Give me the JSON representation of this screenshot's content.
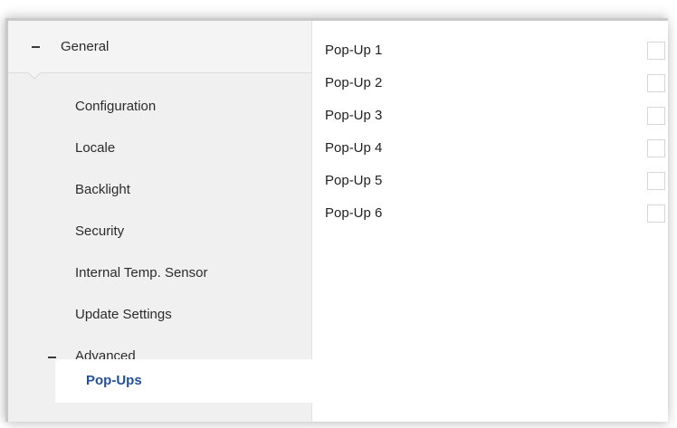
{
  "sidebar": {
    "group_general": {
      "label": "General"
    },
    "items": [
      {
        "label": "Configuration"
      },
      {
        "label": "Locale"
      },
      {
        "label": "Backlight"
      },
      {
        "label": "Security"
      },
      {
        "label": "Internal Temp. Sensor"
      },
      {
        "label": "Update Settings"
      }
    ],
    "group_advanced": {
      "label": "Advanced"
    },
    "selected_item": {
      "label": "Pop-Ups"
    }
  },
  "content": {
    "popups": [
      {
        "label": "Pop-Up 1",
        "checked": false
      },
      {
        "label": "Pop-Up 2",
        "checked": false
      },
      {
        "label": "Pop-Up 3",
        "checked": false
      },
      {
        "label": "Pop-Up 4",
        "checked": false
      },
      {
        "label": "Pop-Up 5",
        "checked": false
      },
      {
        "label": "Pop-Up 6",
        "checked": false
      }
    ]
  },
  "colors": {
    "selected_text": "#23509e",
    "sidebar_bg": "#f0f0f0",
    "checkbox_border": "#d7d7d7"
  }
}
